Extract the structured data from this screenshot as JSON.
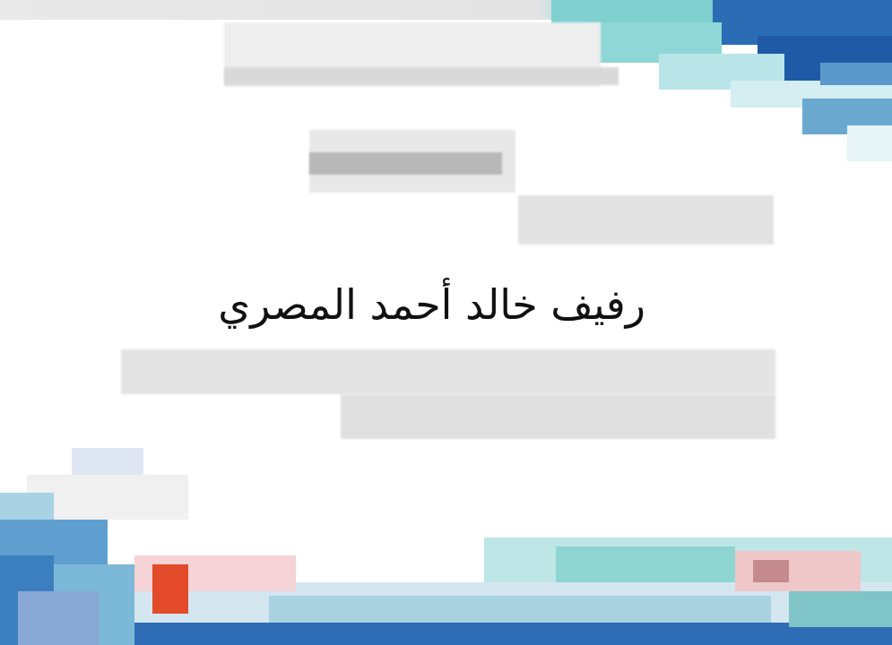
{
  "certificate": {
    "recipient_name": "رفيف خالد أحمد المصري"
  },
  "colors": {
    "dark_blue": "#1f5aa6",
    "teal": "#74cccc",
    "light_gray": "#e3e3e3",
    "red_accent": "#e24a2a",
    "pink_accent": "#f3c3c6"
  }
}
